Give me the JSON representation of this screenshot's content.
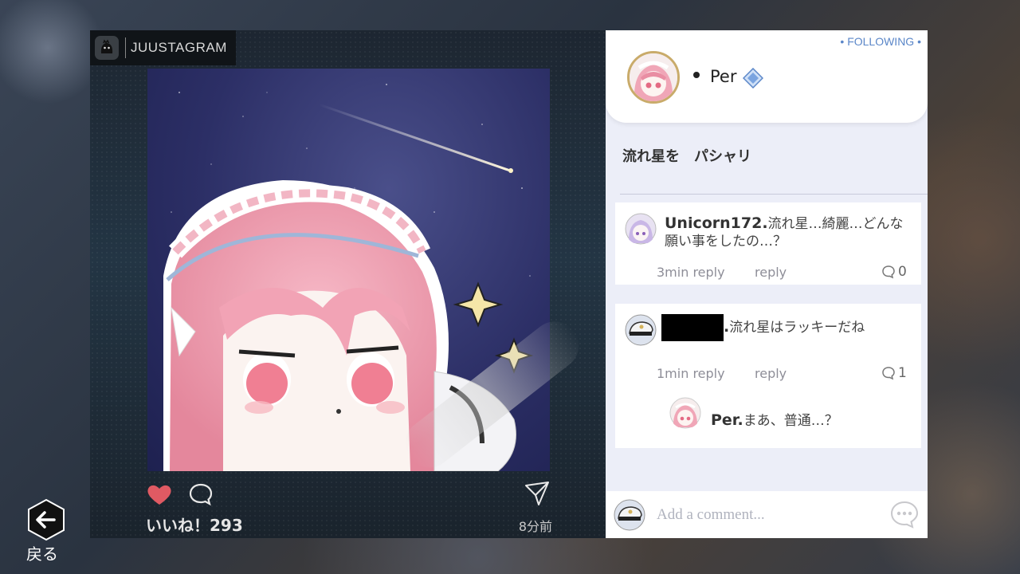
{
  "app": {
    "logo_text": "JUUSTAGRAM"
  },
  "post": {
    "likes_text": "いいね！293",
    "time_ago": "8分前",
    "author": "Per",
    "follow_status": "FOLLOWING",
    "caption": "流れ星を　パシャリ"
  },
  "comments": [
    {
      "author": "Unicorn172.",
      "text": "流れ星…綺麗…どんな願い事をしたの…？",
      "time": "3min",
      "reply_inline": "reply",
      "reply_label": "reply",
      "reply_count": "0"
    },
    {
      "author": ".",
      "text": "流れ星はラッキーだね",
      "time": "1min",
      "reply_inline": "reply",
      "reply_label": "reply",
      "reply_count": "1",
      "replies": [
        {
          "author": "Per.",
          "text": "まあ、普通…？"
        }
      ]
    }
  ],
  "comment_box": {
    "placeholder": "Add a comment..."
  },
  "nav": {
    "back_label": "戻る"
  },
  "colors": {
    "heart": "#e05a63",
    "following": "#5a86c8",
    "panel_bg": "#eceef8"
  }
}
